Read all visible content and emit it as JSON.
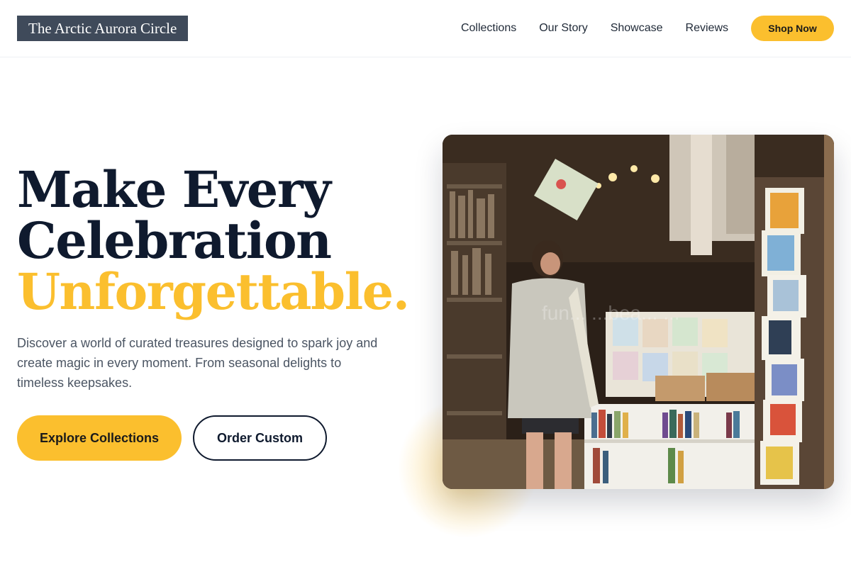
{
  "header": {
    "logo_text": "The Arctic Aurora Circle",
    "nav": [
      {
        "label": "Collections"
      },
      {
        "label": "Our Story"
      },
      {
        "label": "Showcase"
      },
      {
        "label": "Reviews"
      }
    ],
    "cta_label": "Shop Now"
  },
  "hero": {
    "title_line1": "Make Every",
    "title_line2": "Celebration",
    "title_accent": "Unforgettable.",
    "description": "Discover a world of curated treasures designed to spark joy and create magic in every moment. From seasonal delights to timeless keepsakes.",
    "primary_cta": "Explore Collections",
    "secondary_cta": "Order Custom",
    "image_watermark": "fun... ...bea... ..."
  },
  "colors": {
    "accent": "#fbbf2e",
    "heading": "#0f1a2e",
    "logo_bg": "#3f4a5a",
    "body_text": "#4b5563"
  }
}
